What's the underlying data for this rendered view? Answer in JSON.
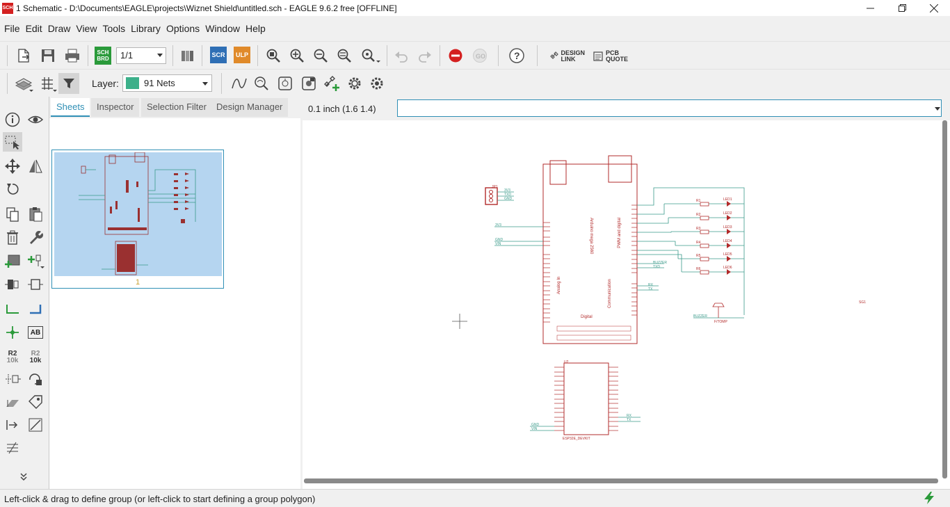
{
  "window": {
    "title": "1 Schematic - D:\\Documents\\EAGLE\\projects\\Wiznet Shield\\untitled.sch - EAGLE 9.6.2 free [OFFLINE]",
    "icon_text": "SCH"
  },
  "menu": [
    "File",
    "Edit",
    "Draw",
    "View",
    "Tools",
    "Library",
    "Options",
    "Window",
    "Help"
  ],
  "toolbar": {
    "sheet_value": "1/1",
    "sch_brd_label": "SCH BRD",
    "scr_label": "SCR",
    "ulp_label": "ULP",
    "design_link_label": "DESIGN LINK",
    "pcb_quote_label": "PCB QUOTE",
    "help_label": "?"
  },
  "layerbar": {
    "layer_label": "Layer:",
    "layer_value": "91 Nets",
    "layer_color": "#3cb08a"
  },
  "lefttools": {
    "r2_label": "R2",
    "r2_value": "10k",
    "ab_label": "AB"
  },
  "panel": {
    "tabs": [
      "Sheets",
      "Inspector",
      "Selection Filter",
      "Design Manager"
    ],
    "active_tab": "Sheets",
    "sheet_number": "1"
  },
  "command": {
    "coordinate": "0.1 inch (1.6 1.4)",
    "input_value": ""
  },
  "schematic": {
    "arduino_labels": [
      "Arduino mega 2560",
      "PWM and digital",
      "Analog In",
      "Communication",
      "Digital"
    ],
    "net_labels": [
      "3V3",
      "GND",
      "VIN",
      "BUZZER",
      "RX",
      "TX",
      "TXD"
    ],
    "parts": [
      "JP1",
      "R1",
      "R2",
      "R3",
      "R4",
      "R5",
      "R6",
      "LED1",
      "LED2",
      "LED3",
      "LED4",
      "LED5",
      "LED6",
      "SG1",
      "U2"
    ],
    "esp_label": "ESP32E_DEVKIT",
    "buzzer_part": "F/TOMP"
  },
  "status": {
    "text": "Left-click & drag to define group (or left-click to start defining a group polygon)"
  },
  "colors": {
    "accent": "#2f8fb5",
    "schematic_red": "#b22b2b",
    "net_green": "#3a9a8a"
  }
}
